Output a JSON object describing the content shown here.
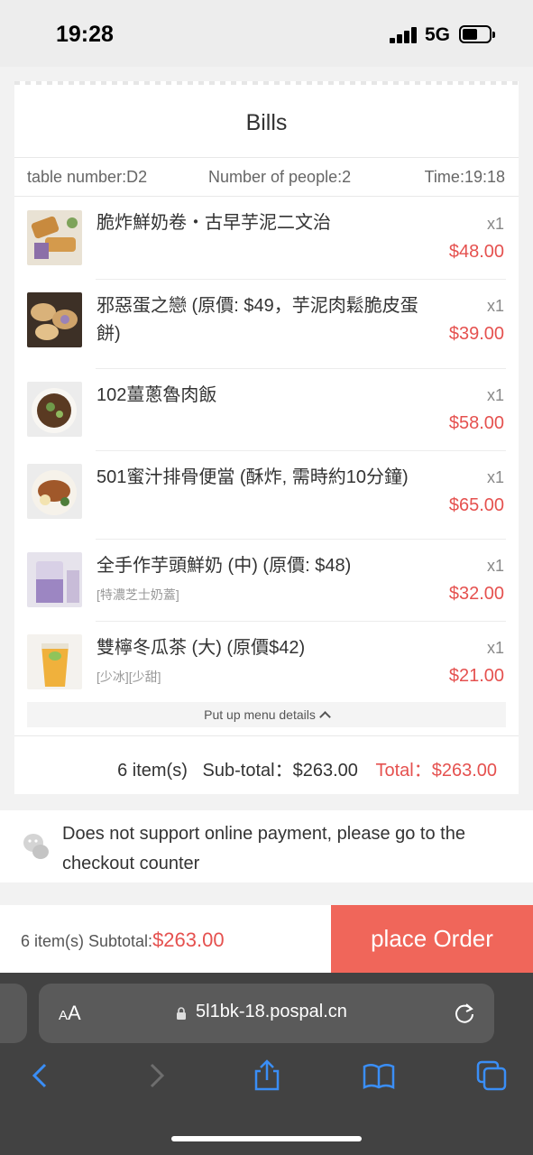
{
  "status": {
    "time": "19:28",
    "network": "5G"
  },
  "bill": {
    "title": "Bills",
    "table": "table number:D2",
    "people": "Number of people:2",
    "time": "Time:19:18",
    "items": [
      {
        "name": "脆炸鮮奶卷・古早芋泥二文治",
        "option": "",
        "qty": "x1",
        "price": "$48.00",
        "thumb": "fried-roll"
      },
      {
        "name": "邪惡蛋之戀 (原價: $49，芋泥肉鬆脆皮蛋餅)",
        "option": "",
        "qty": "x1",
        "price": "$39.00",
        "thumb": "egg-pancake"
      },
      {
        "name": "102薑蔥魯肉飯",
        "option": "",
        "qty": "x1",
        "price": "$58.00",
        "thumb": "braised-pork-rice"
      },
      {
        "name": "501蜜汁排骨便當 (酥炸, 需時約10分鐘)",
        "option": "",
        "qty": "x1",
        "price": "$65.00",
        "thumb": "pork-chop-bento"
      },
      {
        "name": "全手作芋頭鮮奶 (中) (原價: $48)",
        "option": "[特濃芝士奶蓋]",
        "qty": "x1",
        "price": "$32.00",
        "thumb": "taro-milk"
      },
      {
        "name": "雙檸冬瓜茶 (大) (原價$42)",
        "option": "[少冰][少甜]",
        "qty": "x1",
        "price": "$21.00",
        "thumb": "lemon-tea"
      }
    ],
    "collapse_label": "Put up menu details",
    "count": "6 item(s)",
    "subtotal": "Sub-total：$263.00",
    "total": "Total：$263.00"
  },
  "notice": {
    "text": "Does not support online payment, please go to the checkout counter"
  },
  "order_bar": {
    "label": "6 item(s) Subtotal:",
    "amount": "$263.00",
    "button": "place Order"
  },
  "browser": {
    "aa_small": "A",
    "aa_big": "A",
    "url": "5l1bk-18.pospal.cn"
  },
  "colors": {
    "accent": "#e5514f",
    "button": "#f0665a"
  }
}
